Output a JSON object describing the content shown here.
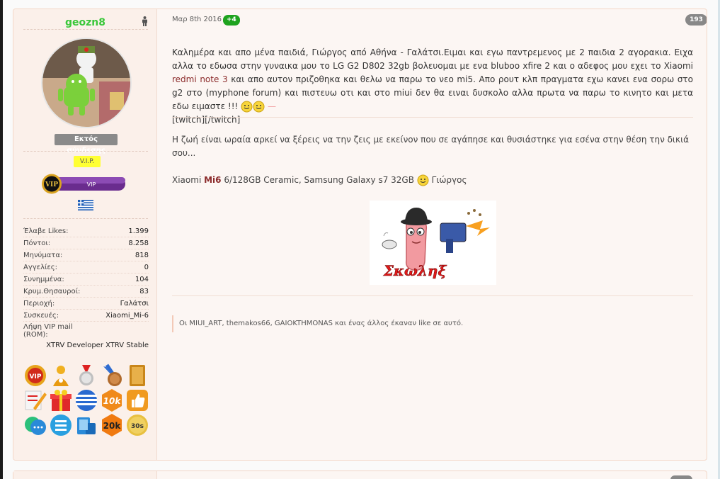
{
  "user": {
    "username": "geozn8",
    "gender_icon": "male-icon",
    "status": "Εκτός σύνδεσης",
    "rank_label": "V.I.P.",
    "rank_banner": "VIP",
    "rank_banner_badge": "VIP",
    "country_flag": "greek-flag-icon",
    "stats": [
      {
        "key": "Έλαβε Likes:",
        "value": "1.399"
      },
      {
        "key": "Πόντοι:",
        "value": "8.258"
      },
      {
        "key": "Μηνύματα:",
        "value": "818"
      },
      {
        "key": "Αγγελίες:",
        "value": "0"
      },
      {
        "key": "Συνημμένα:",
        "value": "104"
      },
      {
        "key": "Κρυμ.Θησαυροί:",
        "value": "83"
      },
      {
        "key": "Περιοχή:",
        "value": "Γαλάτσι"
      },
      {
        "key": "Συσκευές:",
        "value": "Xiaomi_Mi-6"
      }
    ],
    "vip_mail_label": "Λήψη VIP mail (ROM):",
    "vip_mail_value": "XTRV Developer XTRV Stable",
    "medals": [
      {
        "name": "vip-medal-icon",
        "text": "VIP"
      },
      {
        "name": "person-medal-icon",
        "text": ""
      },
      {
        "name": "silver-medal-icon",
        "text": ""
      },
      {
        "name": "bronze-medal-icon",
        "text": ""
      },
      {
        "name": "book-medal-icon",
        "text": ""
      },
      {
        "name": "pencil-note-medal-icon",
        "text": ""
      },
      {
        "name": "gift-medal-icon",
        "text": ""
      },
      {
        "name": "greek-flag-medal-icon",
        "text": ""
      },
      {
        "name": "10k-medal-icon",
        "text": "10k"
      },
      {
        "name": "thumbs-up-medal-icon",
        "text": ""
      },
      {
        "name": "chat-bubbles-medal-icon",
        "text": ""
      },
      {
        "name": "list-medal-icon",
        "text": ""
      },
      {
        "name": "device-medal-icon",
        "text": ""
      },
      {
        "name": "20k-medal-icon",
        "text": "20k"
      },
      {
        "name": "30s-medal-icon",
        "text": "30s"
      }
    ]
  },
  "post": {
    "date": "Μαρ 8th 2016",
    "reputation_badge": "+4",
    "post_number": "193",
    "message_part1": "Καλημέρα και απο μένα παιδιά, Γιώργος από Αθήνα - Γαλάτσι.Ειμαι και εγω παντρεμενος με 2 παιδια 2 αγορακια. Ειχα αλλα το εδωσα στην γυναικα μου το LG G2 D802 32gb βολευομαι με ενα bluboo xfire 2 και ο αδεφος μου εχει το Xiaomi ",
    "message_link": "redmi note 3",
    "message_part2": " και απο αυτον πριζοθηκα και θελω να παρω το νεο mi5. Απο ρουτ κλπ πραγματα εχω κανει ενα σορω στο g2 στο (myphone forum) και πιστευω οτι και στο miui δεν θα ειναι δυσκολο αλλα πρωτα να παρω το κινητο και μετα εδω ειμαστε !!! ",
    "message_tail": "[twitch][/twitch]",
    "signature_line1": "Η ζωή είναι ωραία αρκεί να ξέρεις να την ζεις με εκείνον που σε αγάπησε και θυσιάστηκε για εσένα στην θέση την δικιά σου...",
    "signature_line2_a": "Xiaomi ",
    "signature_line2_b": "Mi6",
    "signature_line2_c": " 6/128GB Ceramic, Samsung Galaxy s7 32GB ",
    "signature_line2_d": " Γιώργος",
    "signature_banner_text": "Σκωληξ",
    "likes_text": "Οι MIUI_ART, themakos66, GAIOKTHMONAS και ένας άλλος έκαναν like σε αυτό."
  },
  "colors": {
    "username": "#39c739",
    "link": "#8b2a2a",
    "badge_green": "#1ea31e"
  }
}
